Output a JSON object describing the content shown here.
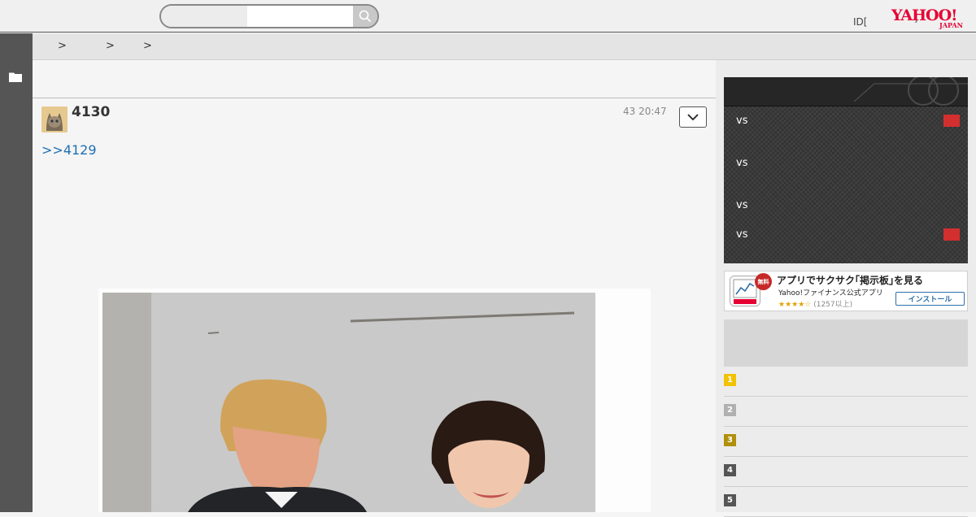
{
  "header": {
    "search": {
      "placeholder": "",
      "value": ""
    },
    "id_label": "ID[",
    "id_sep": "]",
    "logo": {
      "main": "YAHOO!",
      "sub": "JAPAN"
    }
  },
  "breadcrumb": {
    "separators": [
      ">",
      ">",
      ">"
    ]
  },
  "post": {
    "number": "4130",
    "time": "43 20:47",
    "reply_link": ">>4129"
  },
  "scoreboard": {
    "rows": [
      {
        "vs": "vs",
        "has_badge": true
      },
      {
        "vs": "vs",
        "has_badge": false
      },
      {
        "vs": "vs",
        "has_badge": false
      },
      {
        "vs": "vs",
        "has_badge": true
      }
    ]
  },
  "app_banner": {
    "free": "無料",
    "title": "アプリでサクサク｢掲示板｣を見る",
    "subtitle": "Yahoo!ファイナンス公式アプリ",
    "stars": "★★★★☆",
    "rating": "(1257以上)",
    "install": "インストール"
  },
  "ranking": {
    "items": [
      {
        "num": "1",
        "color": "#f2c200"
      },
      {
        "num": "2",
        "color": "#b0b0b0"
      },
      {
        "num": "3",
        "color": "#b0900a"
      },
      {
        "num": "4",
        "color": "#555555"
      },
      {
        "num": "5",
        "color": "#555555"
      }
    ]
  },
  "colors": {
    "accent_link": "#1f6fb2",
    "yahoo_red": "#e60033",
    "score_badge": "#d32f2f"
  }
}
